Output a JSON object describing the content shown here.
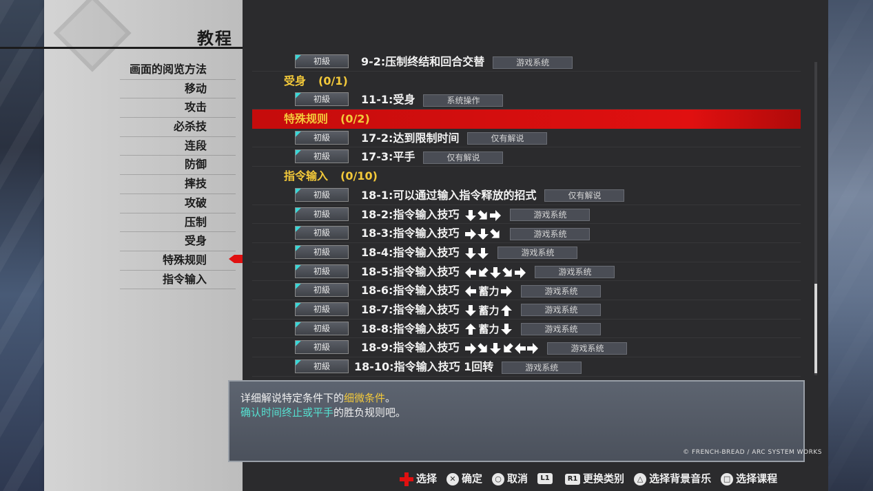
{
  "header": {
    "title": "教程"
  },
  "menu": {
    "items": [
      "画面的阅览方法",
      "移动",
      "攻击",
      "必杀技",
      "连段",
      "防御",
      "摔技",
      "攻破",
      "压制",
      "受身",
      "特殊规则",
      "指令输入"
    ],
    "selected_index": 10
  },
  "list": {
    "rows": [
      {
        "kind": "item",
        "level": "初級",
        "label": "9-2:压制终结和回合交替",
        "arrows": [],
        "tag": "游戏系统"
      },
      {
        "kind": "category",
        "name": "受身",
        "count": "(0/1)"
      },
      {
        "kind": "item",
        "level": "初級",
        "label": "11-1:受身",
        "arrows": [],
        "tag": "系统操作"
      },
      {
        "kind": "category",
        "name": "特殊规则",
        "count": "(0/2)",
        "selected": true
      },
      {
        "kind": "item",
        "level": "初級",
        "label": "17-2:达到限制时间",
        "arrows": [],
        "tag": "仅有解说"
      },
      {
        "kind": "item",
        "level": "初級",
        "label": "17-3:平手",
        "arrows": [],
        "tag": "仅有解说"
      },
      {
        "kind": "category",
        "name": "指令输入",
        "count": "(0/10)"
      },
      {
        "kind": "item",
        "level": "初級",
        "label": "18-1:可以通过输入指令释放的招式",
        "arrows": [],
        "tag": "仅有解说"
      },
      {
        "kind": "item",
        "level": "初級",
        "label": "18-2:指令输入技巧",
        "arrows": [
          "down",
          "down-right",
          "right"
        ],
        "tag": "游戏系统"
      },
      {
        "kind": "item",
        "level": "初級",
        "label": "18-3:指令输入技巧",
        "arrows": [
          "right",
          "down",
          "down-right"
        ],
        "tag": "游戏系统"
      },
      {
        "kind": "item",
        "level": "初級",
        "label": "18-4:指令输入技巧",
        "arrows": [
          "down",
          "down"
        ],
        "tag": "游戏系统"
      },
      {
        "kind": "item",
        "level": "初級",
        "label": "18-5:指令输入技巧",
        "arrows": [
          "left",
          "down-left",
          "down",
          "down-right",
          "right"
        ],
        "tag": "游戏系统"
      },
      {
        "kind": "item",
        "level": "初級",
        "label": "18-6:指令输入技巧",
        "arrows": [
          "left",
          "蓄力",
          "right"
        ],
        "tag": "游戏系统"
      },
      {
        "kind": "item",
        "level": "初級",
        "label": "18-7:指令输入技巧",
        "arrows": [
          "down",
          "蓄力",
          "up"
        ],
        "tag": "游戏系统"
      },
      {
        "kind": "item",
        "level": "初級",
        "label": "18-8:指令输入技巧",
        "arrows": [
          "up",
          "蓄力",
          "down"
        ],
        "tag": "游戏系统"
      },
      {
        "kind": "item",
        "level": "初級",
        "label": "18-9:指令输入技巧",
        "arrows": [
          "right",
          "down-right",
          "down",
          "down-left",
          "left",
          "right"
        ],
        "tag": "游戏系统"
      },
      {
        "kind": "item",
        "level": "初級",
        "label": "18-10:指令输入技巧 1回转",
        "arrows": [],
        "tag": "游戏系统",
        "wide": true
      }
    ]
  },
  "description": {
    "line1_pre": "详细解说特定条件下的",
    "line1_hl": "细微条件",
    "line1_post": "。",
    "line2_hl": "确认时间终止或平手",
    "line2_post": "的胜负规则吧。"
  },
  "copyright": "© FRENCH-BREAD / ARC SYSTEM WORKS",
  "footer": {
    "hints": [
      {
        "icon": "dpad-icon",
        "label": "选择"
      },
      {
        "icon": "cross-button-icon",
        "glyph": "✕",
        "label": "确定"
      },
      {
        "icon": "circle-button-icon",
        "glyph": "○",
        "label": "取消"
      },
      {
        "icon": "l1-button-icon",
        "glyph": "L1",
        "label": ""
      },
      {
        "icon": "r1-button-icon",
        "glyph": "R1",
        "label": "更换类别"
      },
      {
        "icon": "triangle-button-icon",
        "glyph": "△",
        "label": "选择背景音乐"
      },
      {
        "icon": "square-button-icon",
        "glyph": "□",
        "label": "选择课程"
      }
    ]
  },
  "colors": {
    "selected_row": "#e01010",
    "category_text": "#f3c93a",
    "highlight_cyan": "#55e0d0"
  }
}
